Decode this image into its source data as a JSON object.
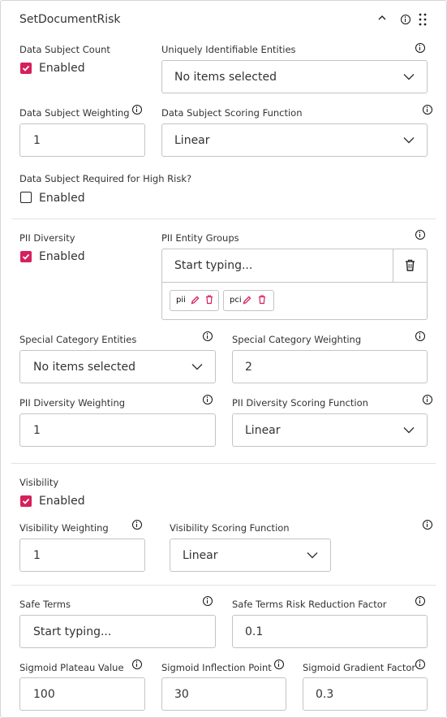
{
  "header": {
    "title": "SetDocumentRisk"
  },
  "data_subject": {
    "count_label": "Data Subject Count",
    "count_enabled_text": "Enabled",
    "count_checked": true,
    "entities_label": "Uniquely Identifiable Entities",
    "entities_value": "No items selected",
    "weighting_label": "Data Subject Weighting",
    "weighting_value": "1",
    "scoring_label": "Data Subject Scoring Function",
    "scoring_value": "Linear",
    "required_label": "Data Subject Required for High Risk?",
    "required_enabled_text": "Enabled",
    "required_checked": false
  },
  "pii": {
    "diversity_label": "PII Diversity",
    "diversity_enabled_text": "Enabled",
    "diversity_checked": true,
    "groups_label": "PII Entity Groups",
    "groups_placeholder": "Start typing...",
    "groups": [
      {
        "label": "pii"
      },
      {
        "label": "pci"
      }
    ],
    "special_label": "Special Category Entities",
    "special_value": "No items selected",
    "special_weight_label": "Special Category Weighting",
    "special_weight_value": "2",
    "div_weight_label": "PII Diversity Weighting",
    "div_weight_value": "1",
    "div_scoring_label": "PII Diversity Scoring Function",
    "div_scoring_value": "Linear"
  },
  "visibility": {
    "label": "Visibility",
    "enabled_text": "Enabled",
    "checked": true,
    "weight_label": "Visibility Weighting",
    "weight_value": "1",
    "scoring_label": "Visibility Scoring Function",
    "scoring_value": "Linear"
  },
  "safe": {
    "terms_label": "Safe Terms",
    "terms_placeholder": "Start typing...",
    "reduction_label": "Safe Terms Risk Reduction Factor",
    "reduction_value": "0.1"
  },
  "sigmoid": {
    "plateau_label": "Sigmoid Plateau Value",
    "plateau_value": "100",
    "inflection_label": "Sigmoid Inflection Point",
    "inflection_value": "30",
    "gradient_label": "Sigmoid Gradient Factor",
    "gradient_value": "0.3"
  },
  "colors": {
    "accent": "#d6205b",
    "border": "#c4c4c4",
    "chip_icon": "#d6205b"
  },
  "icons": [
    "chevron-up-icon",
    "info-icon",
    "drag-handle-icon",
    "chevron-down-icon",
    "trash-icon",
    "pencil-icon"
  ]
}
